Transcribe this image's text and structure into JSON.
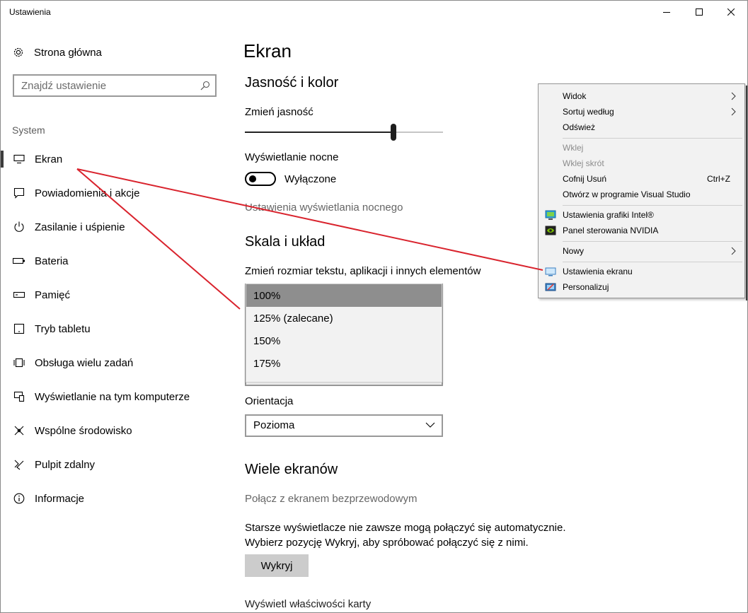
{
  "window": {
    "title": "Ustawienia"
  },
  "sidebar": {
    "home_label": "Strona główna",
    "search_placeholder": "Znajdź ustawienie",
    "section": "System",
    "items": [
      {
        "label": "Ekran",
        "icon": "monitor-icon"
      },
      {
        "label": "Powiadomienia i akcje",
        "icon": "notification-icon"
      },
      {
        "label": "Zasilanie i uśpienie",
        "icon": "power-icon"
      },
      {
        "label": "Bateria",
        "icon": "battery-icon"
      },
      {
        "label": "Pamięć",
        "icon": "storage-icon"
      },
      {
        "label": "Tryb tabletu",
        "icon": "tablet-icon"
      },
      {
        "label": "Obsługa wielu zadań",
        "icon": "multitasking-icon"
      },
      {
        "label": "Wyświetlanie na tym komputerze",
        "icon": "projecting-icon"
      },
      {
        "label": "Wspólne środowisko",
        "icon": "shared-icon"
      },
      {
        "label": "Pulpit zdalny",
        "icon": "remote-desktop-icon"
      },
      {
        "label": "Informacje",
        "icon": "info-icon"
      }
    ]
  },
  "main": {
    "title": "Ekran",
    "brightness": {
      "heading": "Jasność i kolor",
      "label": "Zmień jasność",
      "value": 0.75
    },
    "night_light": {
      "label": "Wyświetlanie nocne",
      "state": "Wyłączone",
      "settings_link": "Ustawienia wyświetlania nocnego"
    },
    "scale": {
      "heading": "Skala i układ",
      "label": "Zmień rozmiar tekstu, aplikacji i innych elementów",
      "options": [
        "100%",
        "125% (zalecane)",
        "150%",
        "175%"
      ],
      "selected": "100%"
    },
    "orientation": {
      "label": "Orientacja",
      "value": "Pozioma"
    },
    "multi": {
      "heading": "Wiele ekranów",
      "wireless_link": "Połącz z ekranem bezprzewodowym",
      "line1": "Starsze wyświetlacze nie zawsze mogą połączyć się automatycznie.",
      "line2": "Wybierz pozycję Wykryj, aby spróbować połączyć się z nimi.",
      "detect_button": "Wykryj",
      "adapter_link": "Wyświetl właściwości karty"
    }
  },
  "context_menu": {
    "items": [
      {
        "label": "Widok",
        "submenu": true
      },
      {
        "label": "Sortuj według",
        "submenu": true
      },
      {
        "label": "Odśwież"
      },
      {
        "label": "Wklej",
        "disabled": true
      },
      {
        "label": "Wklej skrót",
        "disabled": true
      },
      {
        "label": "Cofnij Usuń",
        "shortcut": "Ctrl+Z"
      },
      {
        "label": "Otwórz w programie Visual Studio"
      },
      {
        "label": "Ustawienia grafiki Intel®",
        "icon": "intel-graphics-icon"
      },
      {
        "label": "Panel sterowania NVIDIA",
        "icon": "nvidia-icon"
      },
      {
        "label": "Nowy",
        "submenu": true
      },
      {
        "label": "Ustawienia ekranu",
        "icon": "display-settings-icon"
      },
      {
        "label": "Personalizuj",
        "icon": "personalize-icon"
      }
    ]
  },
  "annotation_color": "#d9232d"
}
